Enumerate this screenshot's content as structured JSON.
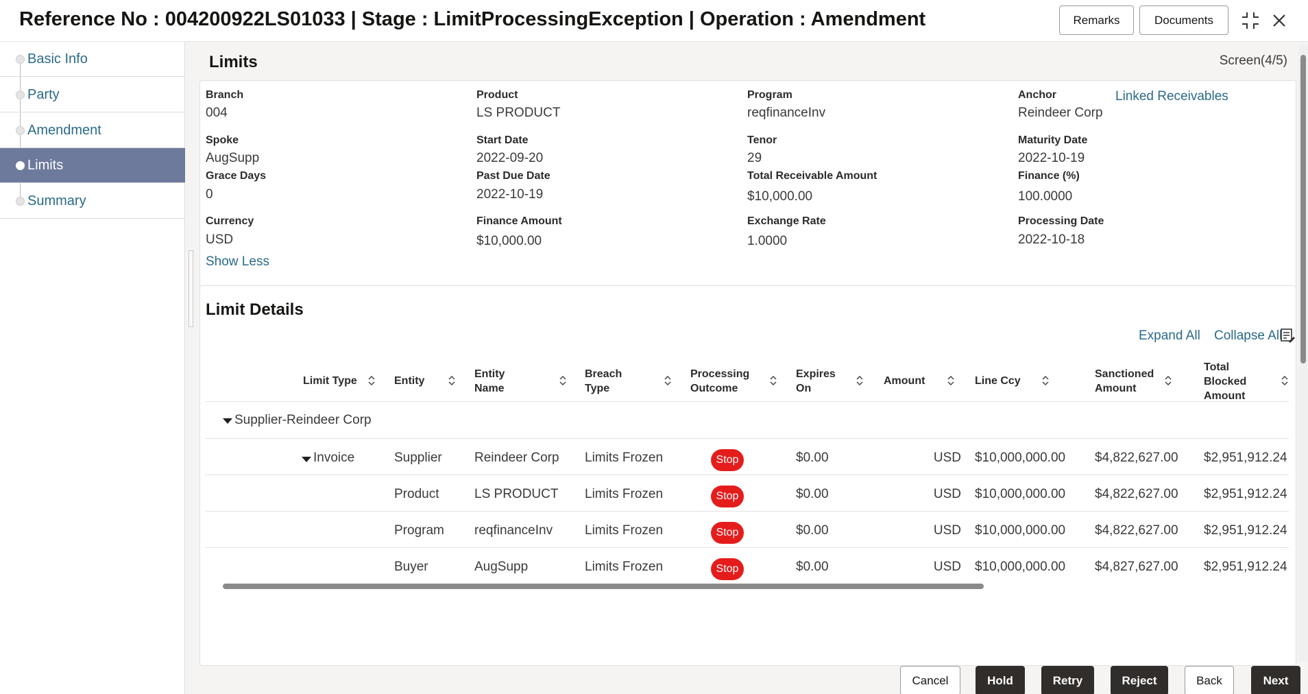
{
  "header": {
    "title": "Reference No : 004200922LS01033 | Stage : LimitProcessingException | Operation : Amendment",
    "remarks_label": "Remarks",
    "documents_label": "Documents"
  },
  "sidebar": {
    "items": [
      {
        "label": "Basic Info"
      },
      {
        "label": "Party"
      },
      {
        "label": "Amendment"
      },
      {
        "label": "Limits"
      },
      {
        "label": "Summary"
      }
    ],
    "active": "Limits"
  },
  "main": {
    "title": "Limits",
    "screen_indicator": "Screen(4/5)",
    "fields": {
      "branch": {
        "label": "Branch",
        "value": "004"
      },
      "product": {
        "label": "Product",
        "value": "LS PRODUCT"
      },
      "program": {
        "label": "Program",
        "value": "reqfinanceInv"
      },
      "anchor": {
        "label": "Anchor",
        "value": "Reindeer Corp"
      },
      "spoke": {
        "label": "Spoke",
        "value": "AugSupp"
      },
      "start_date": {
        "label": "Start Date",
        "value": "2022-09-20"
      },
      "tenor": {
        "label": "Tenor",
        "value": "29"
      },
      "maturity_date": {
        "label": "Maturity Date",
        "value": "2022-10-19"
      },
      "grace_days": {
        "label": "Grace Days",
        "value": "0"
      },
      "past_due_date": {
        "label": "Past Due Date",
        "value": "2022-10-19"
      },
      "total_receivable_amount": {
        "label": "Total Receivable Amount",
        "value": "$10,000.00"
      },
      "finance_pct": {
        "label": "Finance (%)",
        "value": "100.0000"
      },
      "currency": {
        "label": "Currency",
        "value": "USD"
      },
      "finance_amount": {
        "label": "Finance Amount",
        "value": "$10,000.00"
      },
      "exchange_rate": {
        "label": "Exchange Rate",
        "value": "1.0000"
      },
      "processing_date": {
        "label": "Processing Date",
        "value": "2022-10-18"
      }
    },
    "linked_receivables_label": "Linked Receivables",
    "show_less_label": "Show Less"
  },
  "limit_details": {
    "title": "Limit Details",
    "expand_all_label": "Expand All",
    "collapse_all_label": "Collapse All",
    "columns": {
      "limit_type": "Limit Type",
      "entity": "Entity",
      "entity_name": "Entity Name",
      "breach_type": "Breach Type",
      "processing_outcome": "Processing Outcome",
      "expires_on": "Expires On",
      "amount": "Amount",
      "line_ccy": "Line Ccy",
      "sanctioned_amount": "Sanctioned Amount",
      "total_blocked_amount": "Total Blocked Amount"
    },
    "group_label": "Supplier-Reindeer Corp",
    "subgroup_label": "Invoice",
    "rows": [
      {
        "entity": "Supplier",
        "entity_name": "Reindeer Corp",
        "breach_type": "Limits Frozen",
        "outcome": "Stop",
        "expires_on": "$0.00",
        "amount": "USD",
        "line_ccy": "$10,000,000.00",
        "sanctioned": "$4,822,627.00",
        "blocked": "$2,951,912.24"
      },
      {
        "entity": "Product",
        "entity_name": "LS PRODUCT",
        "breach_type": "Limits Frozen",
        "outcome": "Stop",
        "expires_on": "$0.00",
        "amount": "USD",
        "line_ccy": "$10,000,000.00",
        "sanctioned": "$4,822,627.00",
        "blocked": "$2,951,912.24"
      },
      {
        "entity": "Program",
        "entity_name": "reqfinanceInv",
        "breach_type": "Limits Frozen",
        "outcome": "Stop",
        "expires_on": "$0.00",
        "amount": "USD",
        "line_ccy": "$10,000,000.00",
        "sanctioned": "$4,822,627.00",
        "blocked": "$2,951,912.24"
      },
      {
        "entity": "Buyer",
        "entity_name": "AugSupp",
        "breach_type": "Limits Frozen",
        "outcome": "Stop",
        "expires_on": "$0.00",
        "amount": "USD",
        "line_ccy": "$10,000,000.00",
        "sanctioned": "$4,827,627.00",
        "blocked": "$2,951,912.24"
      }
    ]
  },
  "footer": {
    "cancel": "Cancel",
    "hold": "Hold",
    "retry": "Retry",
    "reject": "Reject",
    "back": "Back",
    "next": "Next"
  },
  "colors": {
    "accent_link": "#2a6a8a",
    "active_nav": "#6d7a9c",
    "stop_badge": "#e51c1c",
    "dark_button": "#312d2a"
  }
}
